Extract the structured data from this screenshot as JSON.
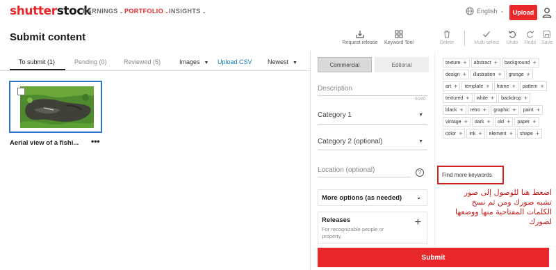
{
  "brand": {
    "logo_part1": "shutter",
    "logo_part2": "stock",
    "accent": "#e8282b"
  },
  "nav": [
    {
      "label": "EARNINGS",
      "caret": "⌄"
    },
    {
      "label": "PORTFOLIO",
      "caret": "⌄"
    },
    {
      "label": "INSIGHTS",
      "caret": "⌄"
    }
  ],
  "language": {
    "label": "English",
    "caret": "⌄"
  },
  "header": {
    "upload_label": "Upload",
    "page_title": "Submit content"
  },
  "toolbar": {
    "request_release": "Request release",
    "keyword_tool": "Keyword Tool",
    "delete": "Delete",
    "multi_select": "Multi-select",
    "undo": "Undo",
    "redo": "Redo",
    "save": "Save"
  },
  "tabs": [
    {
      "label": "To submit (1)",
      "active": true
    },
    {
      "label": "Pending (0)"
    },
    {
      "label": "Reviewed (5)"
    }
  ],
  "filters": {
    "type": "Images",
    "type_caret": "▼",
    "upload_csv": "Upload CSV",
    "sort": "Newest",
    "sort_caret": "▼"
  },
  "images": [
    {
      "title": "Aerial view of a fishi...",
      "more": "•••"
    }
  ],
  "details": {
    "commercial": "Commercial",
    "editorial": "Editorial",
    "description_label": "Description",
    "description_counter": "0/200",
    "category1": "Category 1",
    "category2": "Category 2 (optional)",
    "location": "Location (optional)",
    "help": "?",
    "select_caret": "▼",
    "more_options": "More options (as needed)",
    "more_caret": "⌄",
    "releases_title": "Releases",
    "releases_sub": "For recognizable people or property.",
    "releases_plus": "+",
    "submit": "Submit"
  },
  "keywords": [
    "texture",
    "abstract",
    "background",
    "design",
    "illustration",
    "grunge",
    "art",
    "template",
    "frame",
    "pattern",
    "textured",
    "white",
    "backdrop",
    "black",
    "retro",
    "graphic",
    "paint",
    "vintage",
    "dark",
    "old",
    "paper",
    "color",
    "ink",
    "element",
    "shape"
  ],
  "keyword_add": "+",
  "find_more_keywords": "Find more keywords",
  "annotation": "اضغط هنا للوصول إلى صور تشبه صورك ومن ثم نسخ الكلمات المفتاحية منها ووضعها لصورك"
}
